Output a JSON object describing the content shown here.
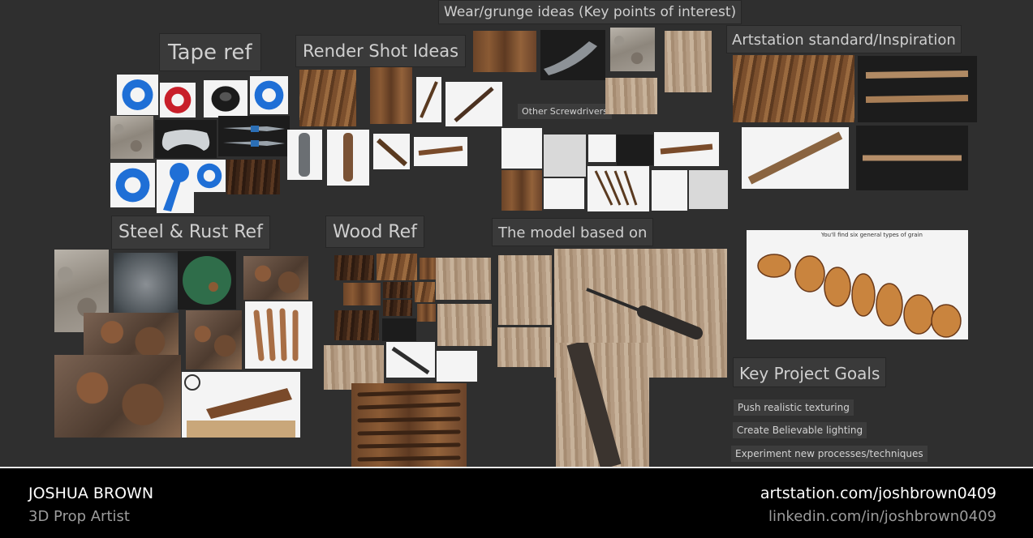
{
  "moodboard": {
    "labels": {
      "wear": "Wear/grunge ideas (Key points of interest)",
      "tape": "Tape ref",
      "render": "Render Shot Ideas",
      "artstation": "Artstation standard/Inspiration",
      "other_screwdrivers": "Other Screwdrivers",
      "steel": "Steel & Rust Ref",
      "wood": "Wood Ref",
      "model": "The model based on",
      "goals": "Key Project Goals"
    },
    "goals": [
      "Push realistic texturing",
      "Create Believable lighting",
      "Experiment new processes/techniques"
    ],
    "grain_chart_title": "You'll find six general types of grain"
  },
  "footer": {
    "name": "JOSHUA BROWN",
    "role": "3D Prop Artist",
    "link1": "artstation.com/joshbrown0409",
    "link2": "linkedin.com/in/joshbrown0409"
  },
  "colors": {
    "background": "#2f2f2f",
    "label_bg": "#3a3a3a",
    "tape_blue": "#1f6fd6",
    "tape_red": "#c81f2a"
  }
}
